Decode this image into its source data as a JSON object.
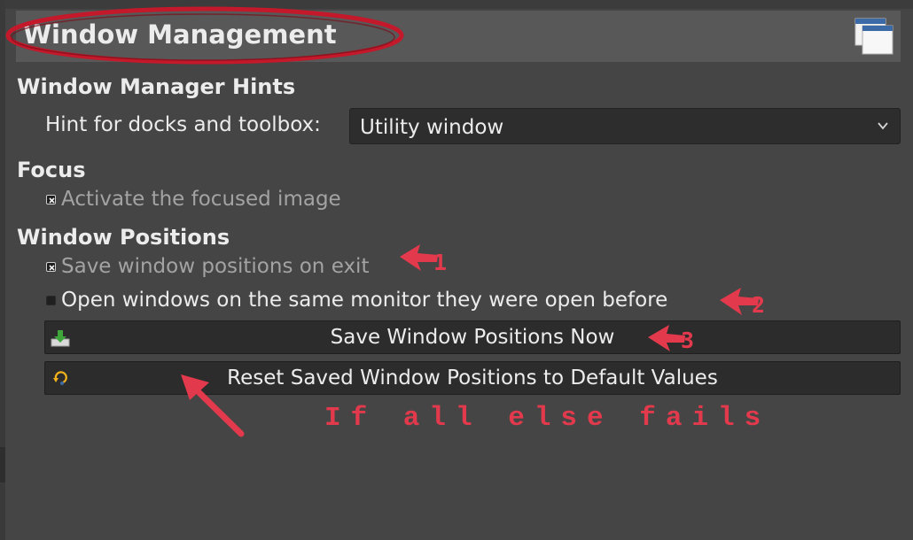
{
  "header": {
    "title": "Window Management",
    "icon": "windows-stack-icon"
  },
  "sections": {
    "hints": {
      "title": "Window Manager Hints"
    },
    "focus": {
      "title": "Focus"
    },
    "positions": {
      "title": "Window Positions"
    }
  },
  "hint_field": {
    "label": "Hint for docks and toolbox:",
    "value": "Utility window",
    "icon": "chevron-down-icon"
  },
  "checks": {
    "activate_focused": {
      "label": "Activate the focused image",
      "checked": true
    },
    "save_on_exit": {
      "label": "Save window positions on exit",
      "checked": true
    },
    "same_monitor": {
      "label": "Open windows on the same monitor they were open before",
      "checked": false
    }
  },
  "buttons": {
    "save_now": {
      "label": "Save Window Positions Now",
      "icon": "save-download-icon"
    },
    "reset": {
      "label": "Reset Saved Window Positions to Default Values",
      "icon": "reset-undo-icon"
    }
  },
  "annotations": {
    "arrow_numbers": [
      "1",
      "2",
      "3"
    ],
    "note": "If all else fails",
    "color": "#e23a4c"
  },
  "colors": {
    "background": "#454545",
    "header": "#585858",
    "field": "#2d2d2d"
  }
}
